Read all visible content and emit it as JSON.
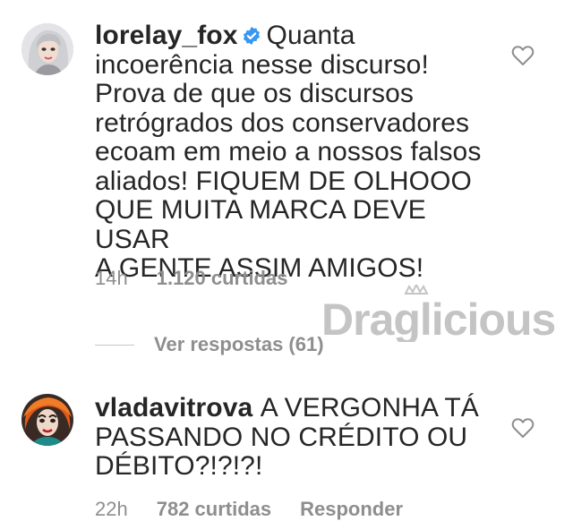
{
  "comments": [
    {
      "username": "lorelay_fox",
      "verified": true,
      "text": "Quanta incoerência nesse discurso! Prova de que os discursos retrógrados dos conservadores ecoam em meio a nossos falsos aliados! FIQUEM DE OLHOOO QUE MUITA MARCA DEVE USAR A GENTE ASSIM AMIGOS!",
      "lines": [
        "Quanta",
        "incoerência nesse discurso!",
        "Prova de que os discursos",
        "retrógrados dos conservadores",
        "ecoam em meio a nossos falsos",
        "aliados! FIQUEM DE OLHOOO",
        "QUE MUITA MARCA DEVE USAR",
        "A GENTE ASSIM AMIGOS!"
      ],
      "time": "14h",
      "likes": "1.120 curtidas",
      "view_replies": "Ver respostas (61)"
    },
    {
      "username": "vladavitrova",
      "verified": false,
      "text": "A VERGONHA TÁ PASSANDO NO CRÉDITO OU DÉBITO?!?!?!",
      "lines": [
        "A VERGONHA TÁ",
        "PASSANDO NO CRÉDITO OU",
        "DÉBITO?!?!?!"
      ],
      "time": "22h",
      "likes": "782 curtidas",
      "reply": "Responder"
    }
  ],
  "watermark": {
    "text": "Draglicious",
    "color": "#c4c4c4"
  },
  "colors": {
    "text": "#262626",
    "meta": "#8e8e8e",
    "verified": "#3897f0",
    "heart": "#8e8e8e"
  },
  "icons": {
    "verified": "verified-badge-icon",
    "like": "heart-outline-icon"
  }
}
